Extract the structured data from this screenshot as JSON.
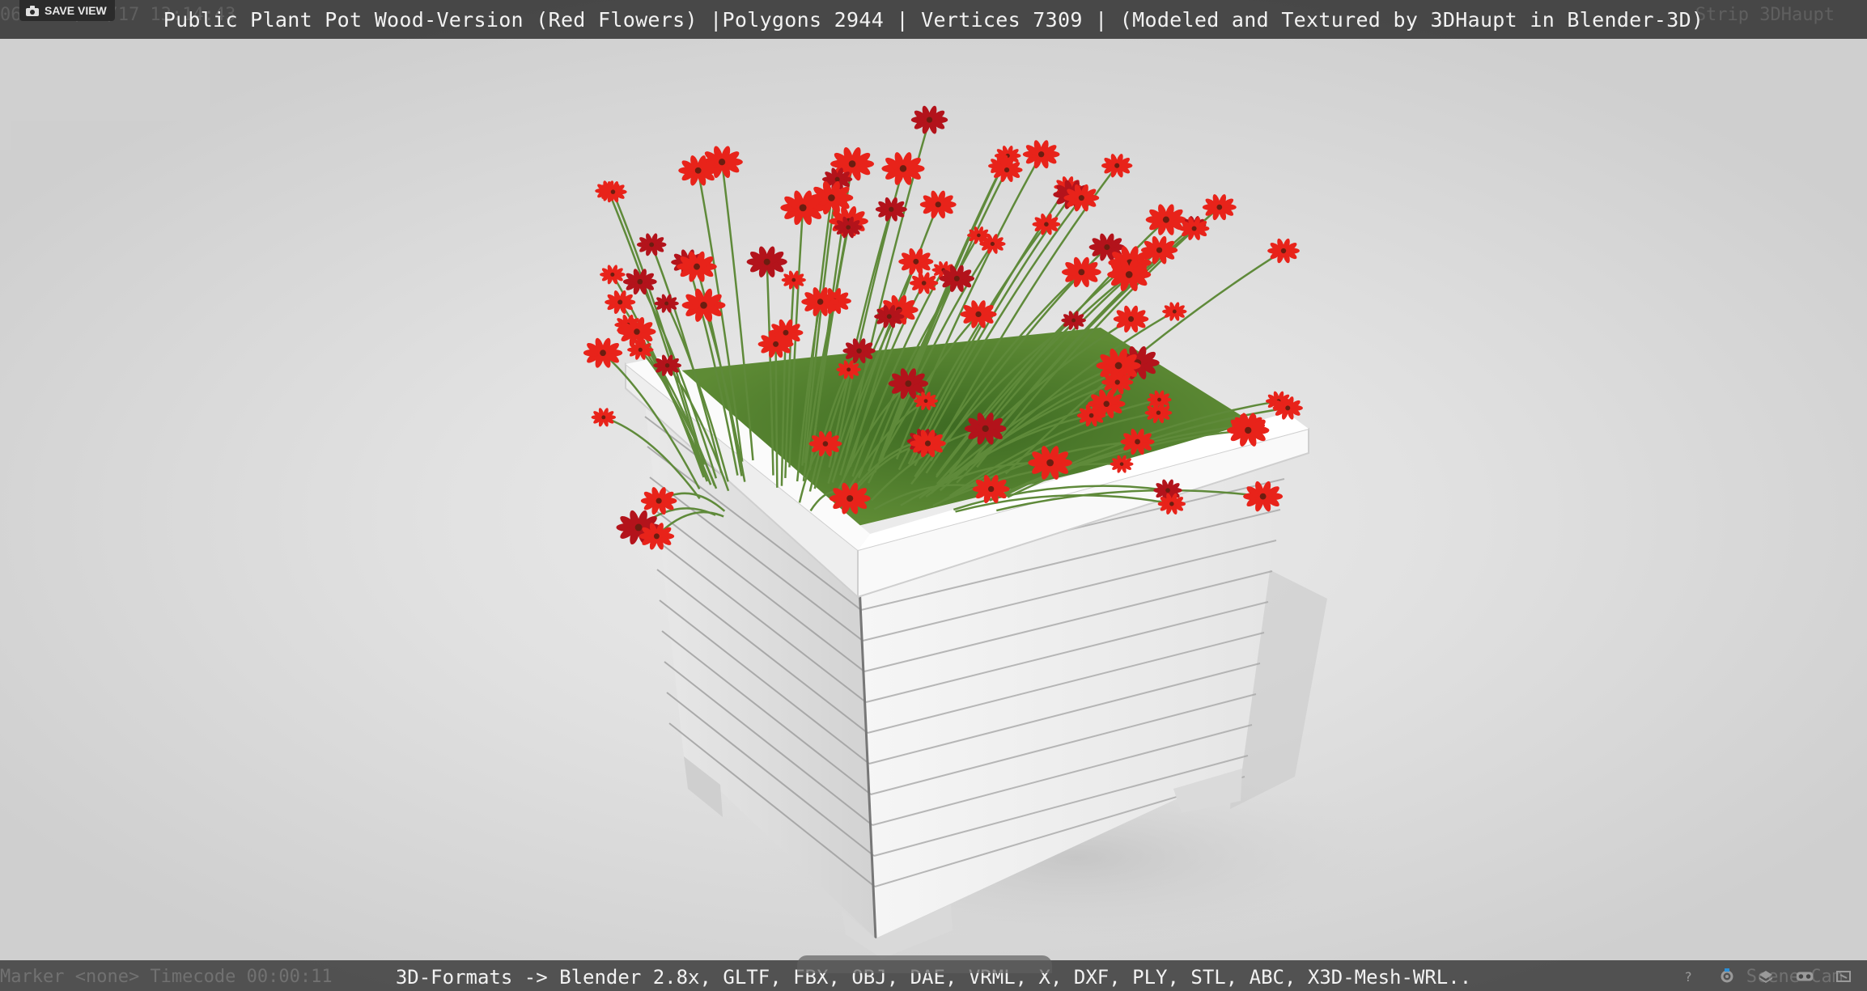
{
  "viewer": {
    "title": "Public Plant Pot Wood-Version (Red Flowers) |Polygons 2944 | Vertices 7309 | (Modeled and Textured by 3DHaupt in Blender-3D)",
    "save_view_label": "SAVE VIEW",
    "formats_text": "3D-Formats -> Blender 2.8x, GLTF, FBX, OBJ, DAE, VRML, X, DXF, PLY, STL, ABC, X3D-Mesh-WRL..",
    "ghost_top_left": "06 2020/07/17 13:14:43",
    "ghost_top_right": "Strip 3DHaupt",
    "ghost_bottom_left": "Marker <none>  Timecode 00:00:11",
    "ghost_bottom_right": "Scene Cam"
  },
  "colors": {
    "flower_red": "#e8231a",
    "flower_dark": "#b3131b",
    "stem_green": "#5f8a3a",
    "pot_white": "#f4f4f4",
    "bar_dark": "#3c3c3c"
  },
  "icons": [
    "camera-icon",
    "help-icon",
    "settings-icon",
    "layers-icon",
    "vr-icon",
    "fullscreen-icon"
  ]
}
